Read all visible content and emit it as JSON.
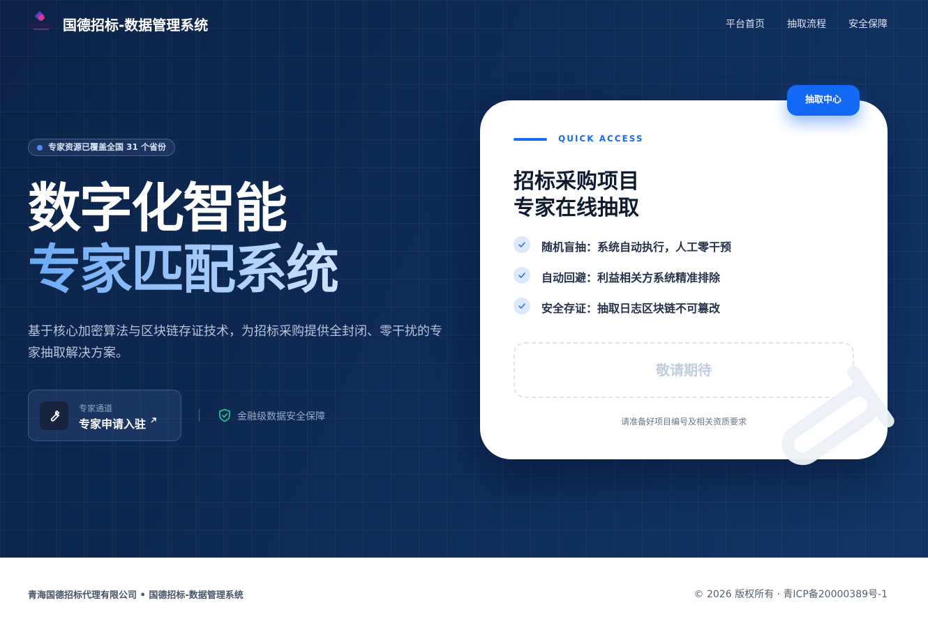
{
  "header": {
    "brand_title": "国德招标-数据管理系统",
    "logo_icon": "brand-logo-icon",
    "nav": [
      "平台首页",
      "抽取流程",
      "安全保障"
    ]
  },
  "hero": {
    "coverage_badge": "专家资源已覆盖全国 31 个省份",
    "title_line1": "数字化智能",
    "title_line2": "专家匹配系统",
    "description": "基于核心加密算法与区块链存证技术，为招标采购提供全封闭、零干扰的专家抽取解决方案。",
    "expert_channel": {
      "sub_label": "专家通道",
      "main_label": "专家申请入驻",
      "icon": "wrench-icon",
      "arrow_icon": "arrow-up-right-icon"
    },
    "security_note": "金融级数据安全保障",
    "security_icon": "shield-check-icon"
  },
  "card": {
    "tag": "抽取中心",
    "eyebrow": "QUICK ACCESS",
    "title_line1": "招标采购项目",
    "title_line2": "专家在线抽取",
    "features": [
      "随机盲抽：系统自动执行，人工零干预",
      "自动回避：利益相关方系统精准排除",
      "安全存证：抽取日志区块链不可篡改"
    ],
    "coming_soon": "敬请期待",
    "note": "请准备好项目编号及相关资质要求"
  },
  "footer": {
    "left": "青海国德招标代理有限公司 • 国德招标-数据管理系统",
    "right": "© 2026 版权所有 · 青ICP备20000389号-1"
  },
  "colors": {
    "hero_bg": "#0e2a55",
    "accent": "#1368f5",
    "title_gradient": "#9ec6fa",
    "success_green": "#22c48a"
  }
}
